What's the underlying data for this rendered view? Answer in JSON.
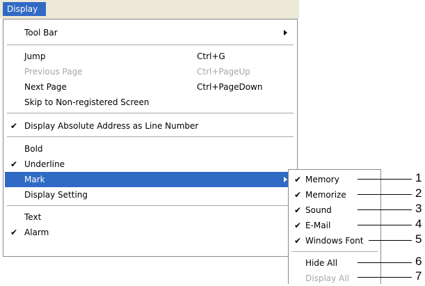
{
  "menubar": {
    "label": "Display"
  },
  "menu": {
    "items": [
      {
        "label": "Tool Bar",
        "has_submenu": true
      },
      {
        "label": "Jump",
        "shortcut": "Ctrl+G"
      },
      {
        "label": "Previous Page",
        "shortcut": "Ctrl+PageUp",
        "disabled": true
      },
      {
        "label": "Next Page",
        "shortcut": "Ctrl+PageDown"
      },
      {
        "label": "Skip to Non-registered Screen"
      },
      {
        "label": "Display Absolute Address as Line Number",
        "checked": true
      },
      {
        "label": "Bold"
      },
      {
        "label": "Underline",
        "checked": true
      },
      {
        "label": "Mark",
        "has_submenu": true,
        "highlighted": true
      },
      {
        "label": "Display Setting"
      },
      {
        "label": "Text"
      },
      {
        "label": "Alarm",
        "checked": true
      }
    ]
  },
  "submenu": {
    "items": [
      {
        "label": "Memory",
        "checked": true
      },
      {
        "label": "Memorize",
        "checked": true
      },
      {
        "label": "Sound",
        "checked": true
      },
      {
        "label": "E-Mail",
        "checked": true
      },
      {
        "label": "Windows Font",
        "checked": true
      },
      {
        "label": "Hide All"
      },
      {
        "label": "Display All",
        "disabled": true
      }
    ]
  },
  "callouts": [
    "1",
    "2",
    "3",
    "4",
    "5",
    "6",
    "7"
  ],
  "glyphs": {
    "check": "✔"
  },
  "colors": {
    "highlight": "#316ac5",
    "disabled": "#a7a7a7",
    "menubar": "#ece9d8"
  }
}
